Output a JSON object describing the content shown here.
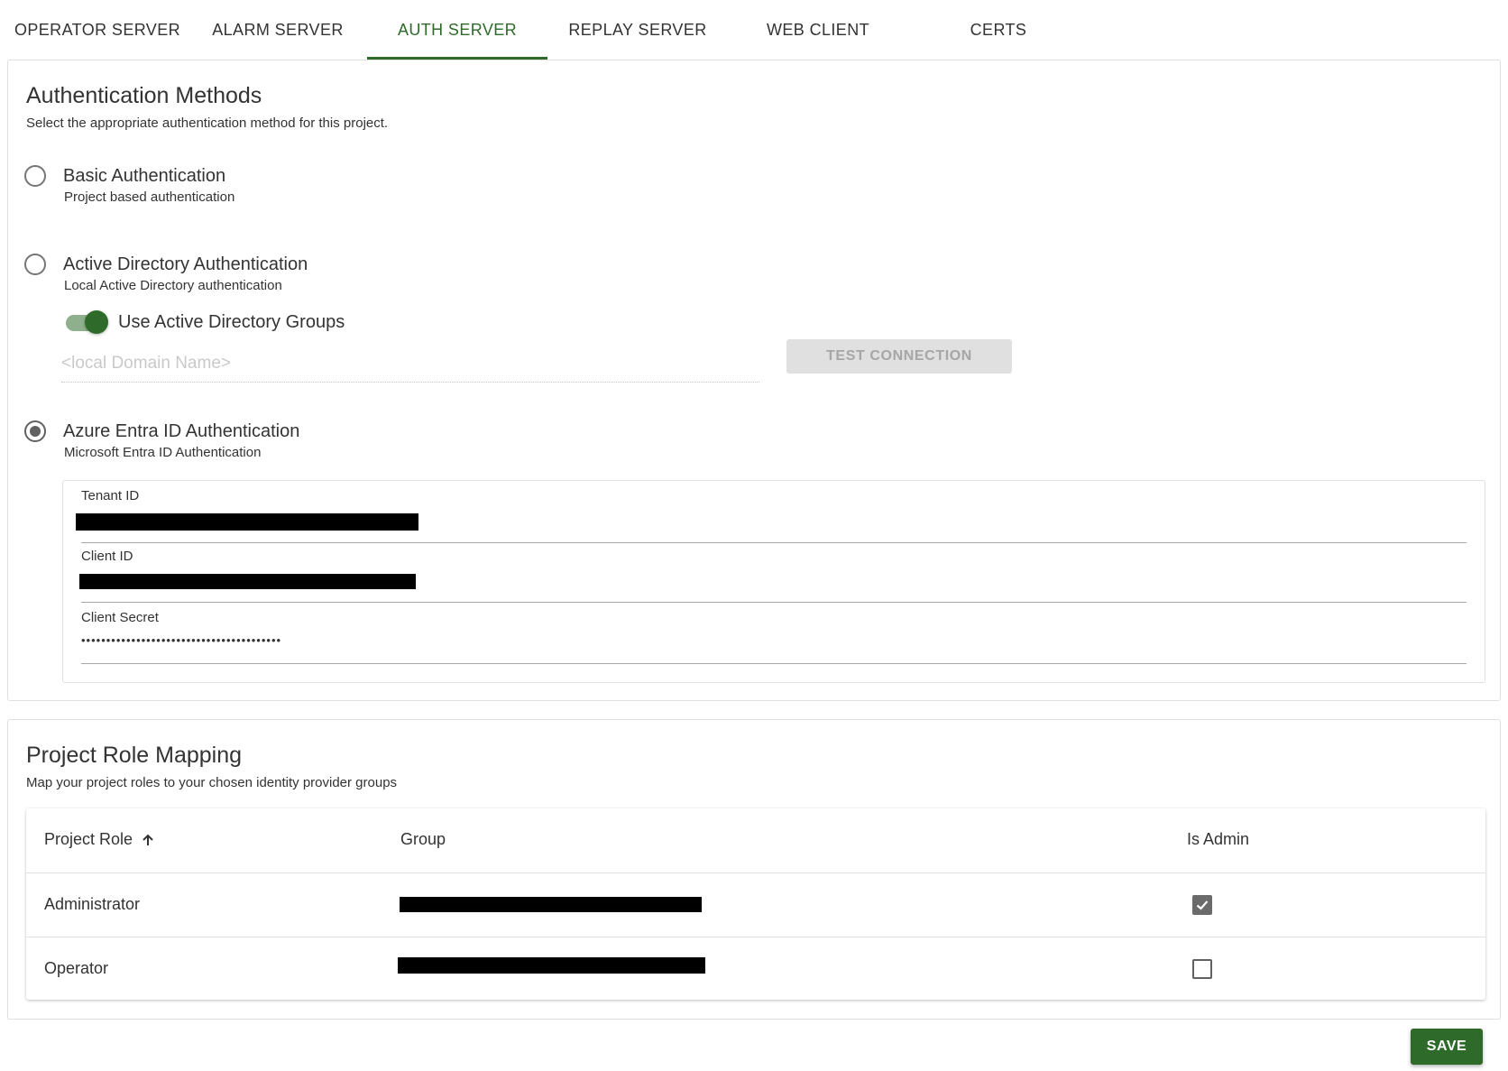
{
  "tabs": [
    {
      "label": "OPERATOR SERVER"
    },
    {
      "label": "ALARM SERVER"
    },
    {
      "label": "AUTH SERVER",
      "active": true
    },
    {
      "label": "REPLAY SERVER"
    },
    {
      "label": "WEB CLIENT"
    },
    {
      "label": "CERTS"
    }
  ],
  "auth": {
    "title": "Authentication Methods",
    "subtitle": "Select the appropriate authentication method for this project.",
    "options": {
      "basic": {
        "title": "Basic Authentication",
        "subtitle": "Project based authentication",
        "selected": false
      },
      "ad": {
        "title": "Active Directory Authentication",
        "subtitle": "Local Active Directory authentication",
        "selected": false
      },
      "azure": {
        "title": "Azure Entra ID Authentication",
        "subtitle": "Microsoft Entra ID Authentication",
        "selected": true
      }
    },
    "use_ad_groups": {
      "label": "Use Active Directory Groups",
      "on": true
    },
    "domain_input": {
      "placeholder": "<local Domain Name>",
      "value": ""
    },
    "test_connection_label": "TEST CONNECTION",
    "azure_fields": {
      "tenant_label": "Tenant ID",
      "client_label": "Client ID",
      "secret_label": "Client Secret",
      "secret_value": "••••••••••••••••••••••••••••••••••••••••"
    }
  },
  "roles": {
    "title": "Project Role Mapping",
    "subtitle": "Map your project roles to your chosen identity provider groups",
    "columns": {
      "role": "Project Role",
      "group": "Group",
      "admin": "Is Admin"
    },
    "sort_icon": "arrow-up-icon",
    "rows": [
      {
        "role": "Administrator",
        "is_admin": true
      },
      {
        "role": "Operator",
        "is_admin": false
      }
    ]
  },
  "save_label": "SAVE",
  "colors": {
    "accent": "#2e6b2a",
    "toggle_track": "#8fb08c",
    "disabled_button": "#e0e0e0"
  }
}
